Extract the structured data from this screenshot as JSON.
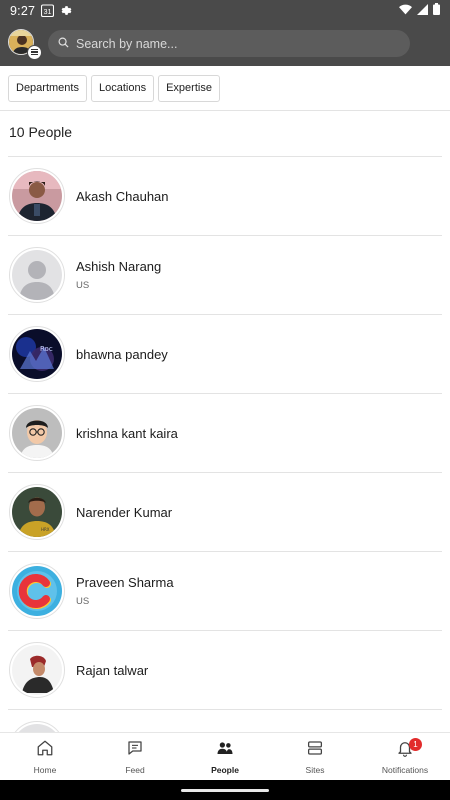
{
  "status_bar": {
    "time": "9:27",
    "calendar_day": "31"
  },
  "header": {
    "search_placeholder": "Search by name..."
  },
  "filters": [
    {
      "label": "Departments"
    },
    {
      "label": "Locations"
    },
    {
      "label": "Expertise"
    }
  ],
  "people_count": "10 People",
  "people": [
    {
      "name": "Akash Chauhan",
      "location": ""
    },
    {
      "name": "Ashish Narang",
      "location": "US"
    },
    {
      "name": "bhawna pandey",
      "location": ""
    },
    {
      "name": "krishna kant kaira",
      "location": ""
    },
    {
      "name": "Narender Kumar",
      "location": ""
    },
    {
      "name": "Praveen Sharma",
      "location": "US"
    },
    {
      "name": "Rajan talwar",
      "location": ""
    }
  ],
  "bottom_nav": [
    {
      "label": "Home",
      "icon": "home-icon"
    },
    {
      "label": "Feed",
      "icon": "chat-icon"
    },
    {
      "label": "People",
      "icon": "people-icon",
      "active": true
    },
    {
      "label": "Sites",
      "icon": "sites-icon"
    },
    {
      "label": "Notifications",
      "icon": "bell-icon",
      "badge": "1"
    }
  ],
  "colors": {
    "header_bg": "#4a4a4a",
    "badge_red": "#e22b2b"
  }
}
